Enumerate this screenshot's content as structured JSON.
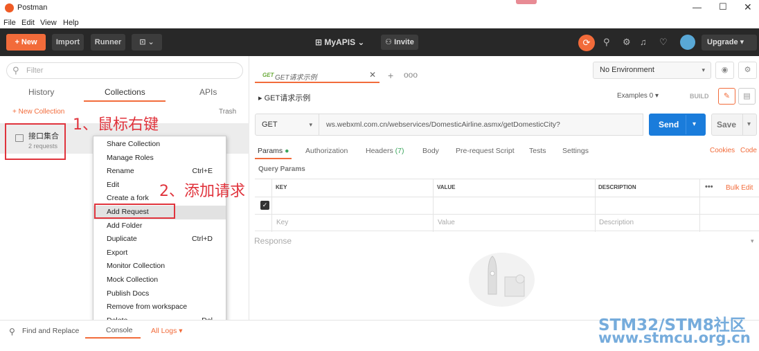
{
  "window": {
    "title": "Postman",
    "minimize": "—",
    "maximize": "☐",
    "close": "✕"
  },
  "menubar": {
    "items": [
      "File",
      "Edit",
      "View",
      "Help"
    ]
  },
  "toolbar": {
    "new_label": "+  New",
    "import_label": "Import",
    "runner_label": "Runner",
    "layout_icon": "⊡ ⌄",
    "workspace_label": "⊞  MyAPIS  ⌄",
    "invite_label": "⚇ Invite",
    "upgrade_label": "Upgrade  ▾",
    "brand_color": "#f26b3a"
  },
  "sidebar": {
    "filter_placeholder": "Filter",
    "tabs": [
      "History",
      "Collections",
      "APIs"
    ],
    "new_collection_label": "+ New Collection",
    "trash_label": "Trash",
    "collection": {
      "name": "接口集合",
      "count": "2 requests"
    }
  },
  "annotations": {
    "step1": "1、鼠标右键",
    "step2": "2、添加请求",
    "color": "#e0333c"
  },
  "context_menu": {
    "items": [
      {
        "label": "Share Collection",
        "shortcut": ""
      },
      {
        "label": "Manage Roles",
        "shortcut": ""
      },
      {
        "label": "Rename",
        "shortcut": "Ctrl+E"
      },
      {
        "label": "Edit",
        "shortcut": ""
      },
      {
        "label": "Create a fork",
        "shortcut": ""
      },
      {
        "label": "Add Request",
        "shortcut": ""
      },
      {
        "label": "Add Folder",
        "shortcut": ""
      },
      {
        "label": "Duplicate",
        "shortcut": "Ctrl+D"
      },
      {
        "label": "Export",
        "shortcut": ""
      },
      {
        "label": "Monitor Collection",
        "shortcut": ""
      },
      {
        "label": "Mock Collection",
        "shortcut": ""
      },
      {
        "label": "Publish Docs",
        "shortcut": ""
      },
      {
        "label": "Remove from workspace",
        "shortcut": ""
      },
      {
        "label": "Delete",
        "shortcut": "Del"
      }
    ]
  },
  "request_tab": {
    "method_tag": "GET",
    "name": "GET请求示例",
    "close": "✕",
    "plus": "+",
    "more": "ooo"
  },
  "environment": {
    "selected": "No Environment",
    "eye_icon": "◉",
    "sliders_icon": "⚙"
  },
  "request": {
    "title": "▸  GET请求示例",
    "examples": "Examples  0  ▾",
    "build": "BUILD",
    "method": "GET",
    "url": "ws.webxml.com.cn/webservices/DomesticAirline.asmx/getDomesticCity?",
    "send_label": "Send",
    "save_label": "Save"
  },
  "request_tabs": {
    "params": "Params",
    "authorization": "Authorization",
    "headers": "Headers",
    "headers_count": "(7)",
    "body": "Body",
    "prerequest": "Pre-request Script",
    "tests": "Tests",
    "settings": "Settings",
    "cookies": "Cookies",
    "code": "Code"
  },
  "query_params": {
    "label": "Query Params",
    "columns": [
      "KEY",
      "VALUE",
      "DESCRIPTION"
    ],
    "more": "•••",
    "bulk_edit": "Bulk Edit",
    "placeholders": {
      "key": "Key",
      "value": "Value",
      "description": "Description"
    }
  },
  "response": {
    "label": "Response"
  },
  "bottom": {
    "find_replace": "Find and Replace",
    "console": "Console",
    "all_logs": "All Logs  ▾"
  },
  "watermark": {
    "line1": "STM32/STM8社区",
    "line2": "www.stmcu.org.cn"
  }
}
